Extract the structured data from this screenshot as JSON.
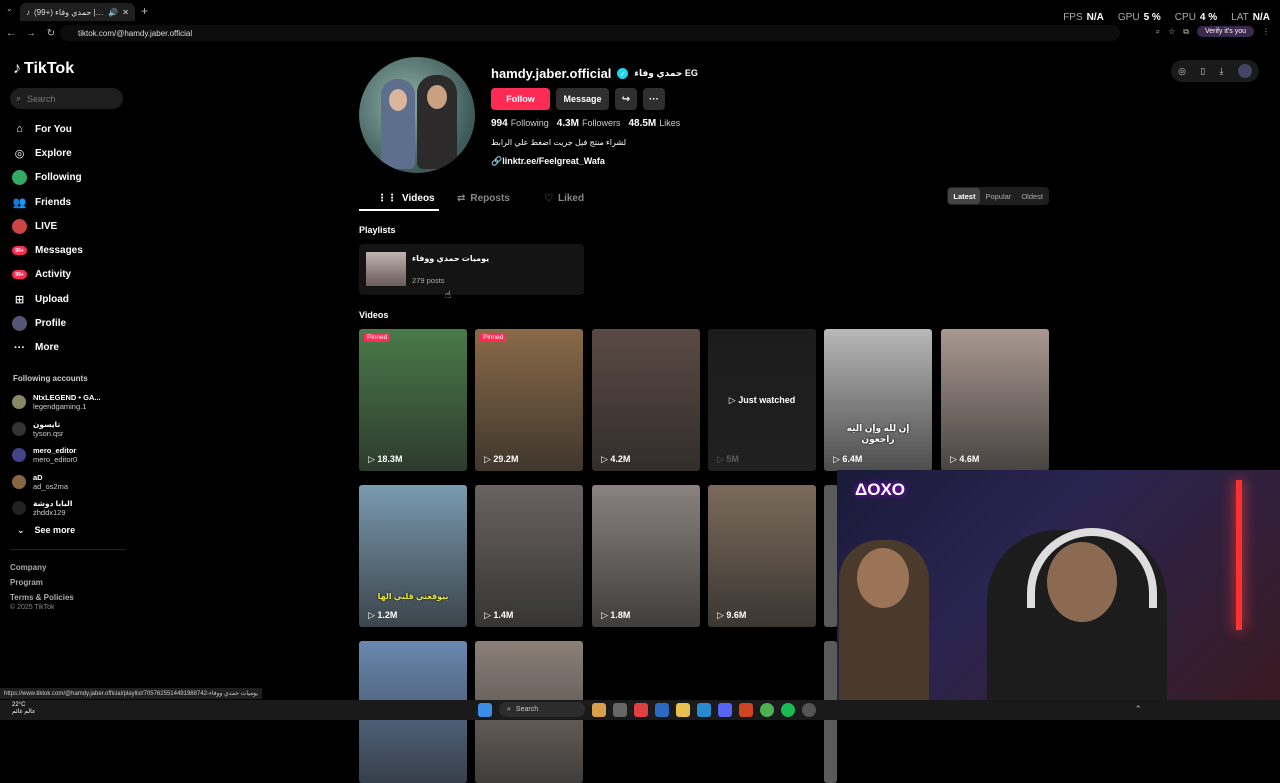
{
  "browser": {
    "tab_title": "(99+) حمدي وفاء | TikTok",
    "new_tab": "+",
    "stats": [
      {
        "label": "FPS",
        "value": "N/A"
      },
      {
        "label": "GPU",
        "value": "5 %"
      },
      {
        "label": "CPU",
        "value": "4 %"
      },
      {
        "label": "LAT",
        "value": "N/A"
      }
    ],
    "url": "tiktok.com/@hamdy.jaber.official",
    "verify_label": "Verify it's you",
    "status_url": "https://www.tiktok.com/@hamdy.jaber.official/playlist/7057625514491988742-يوميات حمدي ووفاء"
  },
  "sidebar": {
    "logo": "TikTok",
    "search_placeholder": "Search",
    "nav": [
      {
        "label": "For You",
        "icon": "home-icon"
      },
      {
        "label": "Explore",
        "icon": "compass-icon"
      },
      {
        "label": "Following",
        "icon": "following-avatar-icon"
      },
      {
        "label": "Friends",
        "icon": "friends-icon"
      },
      {
        "label": "LIVE",
        "icon": "live-icon"
      },
      {
        "label": "Messages",
        "icon": "messages-icon",
        "badge": "99+"
      },
      {
        "label": "Activity",
        "icon": "activity-icon",
        "badge": "99+"
      },
      {
        "label": "Upload",
        "icon": "upload-icon"
      },
      {
        "label": "Profile",
        "icon": "profile-icon"
      },
      {
        "label": "More",
        "icon": "more-icon"
      }
    ],
    "following_title": "Following accounts",
    "accounts": [
      {
        "name": "NtxLEGEND • GA...",
        "handle": "legendgaming.1"
      },
      {
        "name": "تايسون",
        "handle": "tyson.qsr"
      },
      {
        "name": "mero_editor",
        "handle": "mero_editor0"
      },
      {
        "name": "aD",
        "handle": "ad_os2ma"
      },
      {
        "name": "البابا دوشة",
        "handle": "zhddx129"
      }
    ],
    "see_more": "See more",
    "footer": [
      "Company",
      "Program",
      "Terms & Policies"
    ],
    "copyright": "© 2025 TikTok"
  },
  "profile": {
    "username": "hamdy.jaber.official",
    "nickname": "حمدي وفاء EG",
    "follow_label": "Follow",
    "message_label": "Message",
    "following_count": "994",
    "following_label": "Following",
    "followers_count": "4.3M",
    "followers_label": "Followers",
    "likes_count": "48.5M",
    "likes_label": "Likes",
    "bio": "لشراء منتج فيل جريت اضغط علي الرابط",
    "link": "linktr.ee/Feelgreat_Wafa"
  },
  "tabs": {
    "videos": "Videos",
    "reposts": "Reposts",
    "liked": "Liked",
    "sort": [
      "Latest",
      "Popular",
      "Oldest"
    ]
  },
  "playlists_title": "Playlists",
  "playlist": {
    "name": "يوميات حمدي ووفاء",
    "count": "279 posts"
  },
  "videos_title": "Videos",
  "videos": [
    {
      "views": "18.3M",
      "pinned": "Pinned",
      "color": "#4a7a4a"
    },
    {
      "views": "29.2M",
      "pinned": "Pinned",
      "color": "#8a6a48"
    },
    {
      "views": "4.2M",
      "color": "#5a4a44"
    },
    {
      "views": "5M",
      "watched": "Just watched",
      "color": "#1c1c1c"
    },
    {
      "views": "6.4M",
      "caption": "إن لله وإن اليه راجعون",
      "color": "#b8b8b8"
    },
    {
      "views": "4.6M",
      "color": "#a89890"
    },
    {
      "views": "1.2M",
      "caption": "بيوقعني قلبي الها",
      "color": "#7a9ab0"
    },
    {
      "views": "1.4M",
      "color": "#6a6262"
    },
    {
      "views": "1.8M",
      "color": "#8a8280"
    },
    {
      "views": "9.6M",
      "color": "#7a6a5a"
    },
    {
      "views": "",
      "color": "#5a4030"
    },
    {
      "views": "",
      "color": "#c0b8b0"
    },
    {
      "views": "",
      "color": "#6a88b0"
    },
    {
      "views": "",
      "color": "#8a8078"
    }
  ],
  "overlay": {
    "ps_logo": "ΔOXO"
  },
  "taskbar": {
    "weather_temp": "22°C",
    "weather_desc": "عالم غائم",
    "search": "Search"
  }
}
